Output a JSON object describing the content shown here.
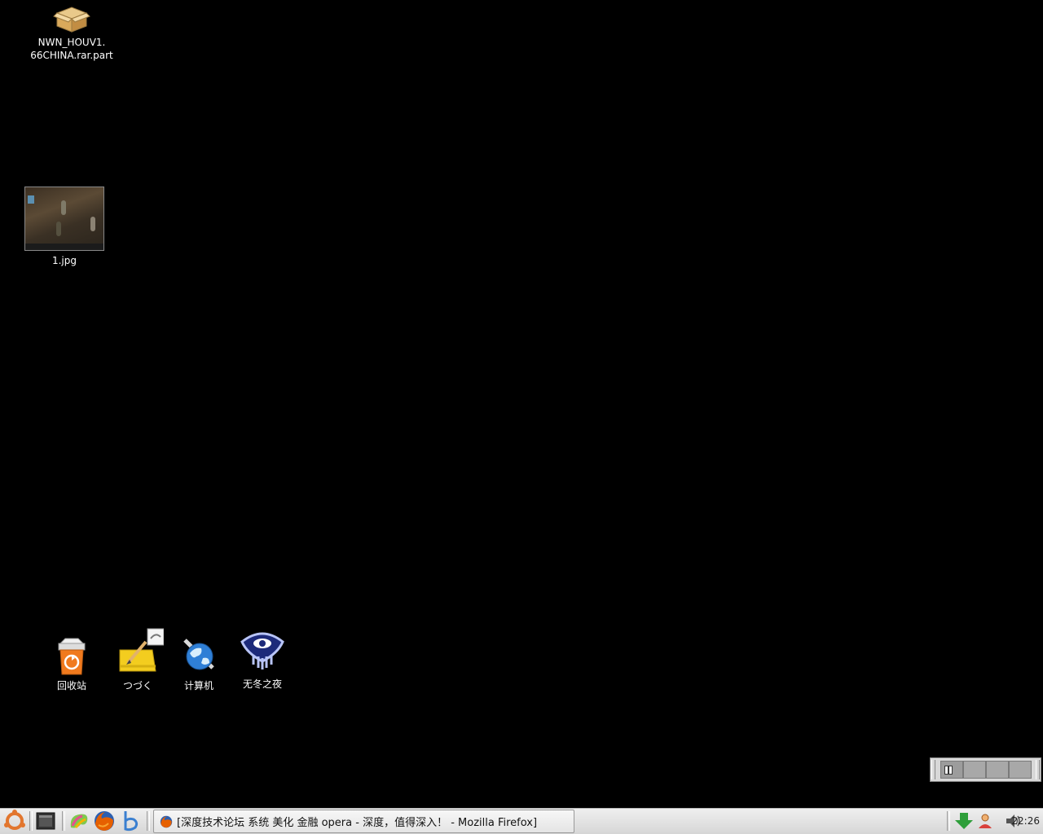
{
  "desktop": {
    "icons_top": [
      {
        "name": "NWN_HOUV1.\n66CHINA.rar.part",
        "icon": "archive-icon"
      },
      {
        "name": "1.jpg",
        "icon": "image-thumbnail"
      }
    ],
    "icons_bottom": [
      {
        "name": "回收站",
        "icon": "trash-icon"
      },
      {
        "name": "つづく",
        "icon": "notepad-icon"
      },
      {
        "name": "计算机",
        "icon": "computer-globe-icon"
      },
      {
        "name": "无冬之夜",
        "icon": "neverwinter-nights-icon"
      }
    ]
  },
  "panel": {
    "launchers": [
      {
        "icon": "ubuntu-menu-icon"
      },
      {
        "icon": "show-desktop-icon"
      },
      {
        "icon": "paint-app-icon"
      },
      {
        "icon": "firefox-icon"
      },
      {
        "icon": "b-app-icon"
      }
    ],
    "task": {
      "title": "[深度技术论坛 系统 美化 金融 opera - 深度，值得深入！ -  Mozilla Firefox]",
      "icon": "firefox-icon"
    },
    "tray": [
      {
        "icon": "download-arrow-icon"
      },
      {
        "icon": "user-icon"
      },
      {
        "icon": "volume-icon"
      }
    ],
    "clock": "22:26"
  },
  "pager": {
    "workspaces": 4,
    "active": 1
  },
  "colors": {
    "desktop_bg": "#000000",
    "panel_bg": "#dcdcdc",
    "accent_orange": "#e2762e"
  }
}
